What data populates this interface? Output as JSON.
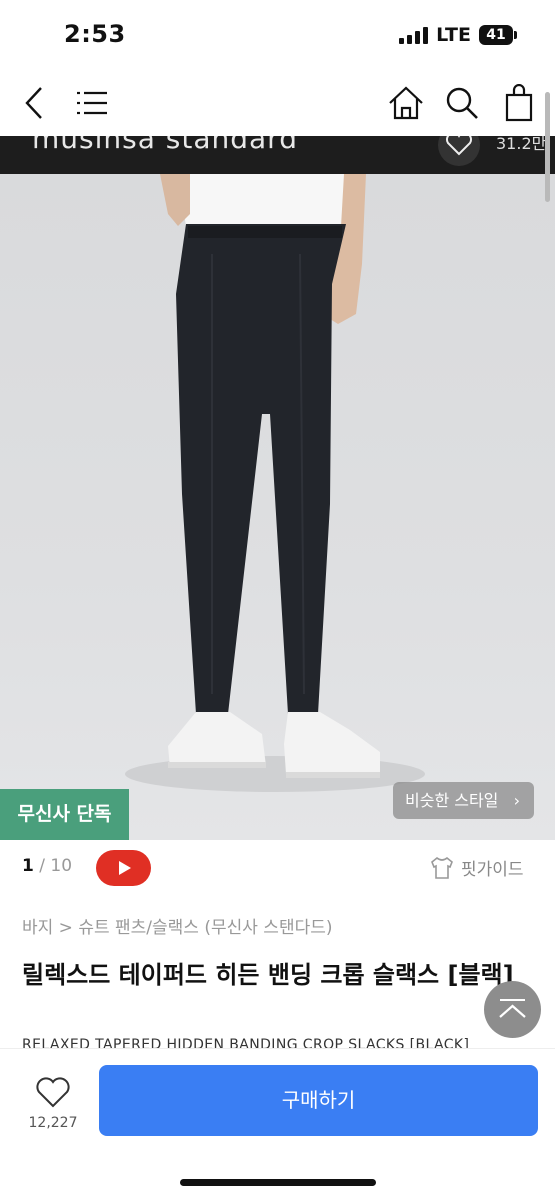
{
  "status_bar": {
    "time": "2:53",
    "network": "LTE",
    "battery": "41"
  },
  "nav": {
    "back_icon": "chevron-left-icon",
    "menu_icon": "hamburger-icon",
    "home_icon": "home-icon",
    "search_icon": "search-icon",
    "cart_icon": "shopping-bag-icon"
  },
  "brand_strip": {
    "brand": "musinsa standard",
    "likes": "31.2만"
  },
  "hero": {
    "exclusive_badge": "무신사 단독",
    "similar_style": "비슷한 스타일",
    "colors": {
      "exclusive": "#4a9f7c",
      "pants": "#22252b"
    }
  },
  "pager": {
    "current": "1",
    "sep": " / ",
    "total": "10"
  },
  "fit_guide": "핏가이드",
  "breadcrumb": "바지 > 슈트 팬츠/슬랙스 (무신사 스탠다드)",
  "product": {
    "title": "릴렉스드 테이퍼드 히든 밴딩 크롭 슬랙스 [블랙]",
    "subtitle": "RELAXED TAPERED HIDDEN BANDING CROP SLACKS [BLACK]"
  },
  "bottom_bar": {
    "wish_count": "12,227",
    "buy_label": "구매하기",
    "buy_color": "#3a7ef3"
  }
}
